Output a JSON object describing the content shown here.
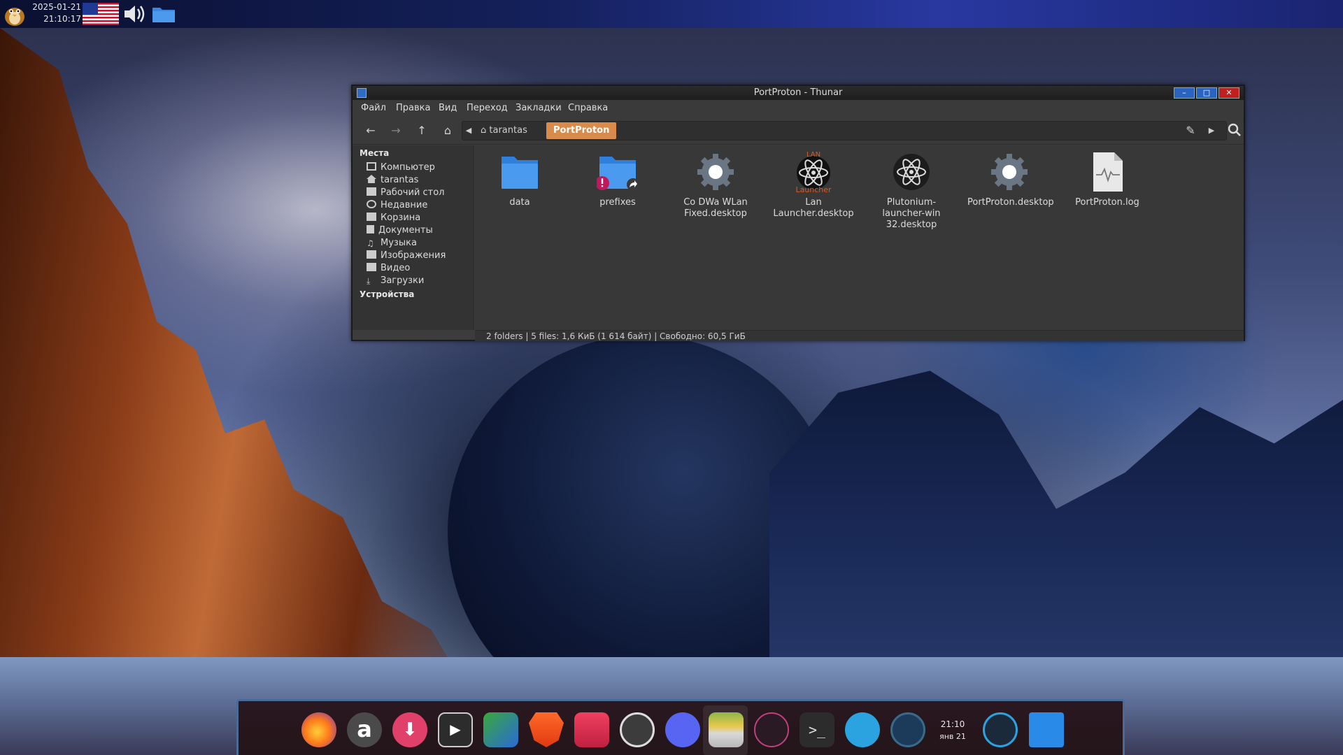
{
  "top_panel": {
    "date": "2025-01-21",
    "time": "21:10:17",
    "icons": [
      "tux-logo-icon",
      "us-flag-icon",
      "volume-icon",
      "folder-icon"
    ]
  },
  "window": {
    "title": "PortProton - Thunar",
    "menu": [
      "Файл",
      "Правка",
      "Вид",
      "Переход",
      "Закладки",
      "Справка"
    ],
    "breadcrumb": {
      "home": "tarantas",
      "current": "PortProton"
    },
    "sidebar": {
      "section_places": "Места",
      "places": [
        "Компьютер",
        "tarantas",
        "Рабочий стол",
        "Недавние",
        "Корзина",
        "Документы",
        "Музыка",
        "Изображения",
        "Видео",
        "Загрузки"
      ],
      "section_devices": "Устройства"
    },
    "files": [
      {
        "name": "data",
        "kind": "folder"
      },
      {
        "name": "prefixes",
        "kind": "folder-link"
      },
      {
        "name": "Co DWa WLan Fixed.desktop",
        "kind": "gear"
      },
      {
        "name": "Lan Launcher.desktop",
        "kind": "lan"
      },
      {
        "name": "Plutonium-launcher-win 32.desktop",
        "kind": "atom"
      },
      {
        "name": "PortProton.desktop",
        "kind": "gear"
      },
      {
        "name": "PortProton.log",
        "kind": "log"
      }
    ],
    "lan_icon_text": {
      "top": "LAN",
      "bottom": "Launcher"
    },
    "status": "2 folders  |  5 files: 1,6 КиБ (1 614 байт)  |  Свободно: 60,5 ГиБ"
  },
  "dock": {
    "clock_time": "21:10",
    "clock_date": "янв 21",
    "apps": [
      "firefox-icon",
      "app-store-icon",
      "downloader-icon",
      "media-player-icon",
      "xnview-icon",
      "brave-icon",
      "screenshot-icon",
      "obs-icon",
      "discord-icon",
      "file-manager-icon",
      "atom-icon",
      "terminal-icon",
      "telegram-icon",
      "system-monitor-icon",
      "resource-monitor-icon",
      "desktop-icon"
    ]
  }
}
